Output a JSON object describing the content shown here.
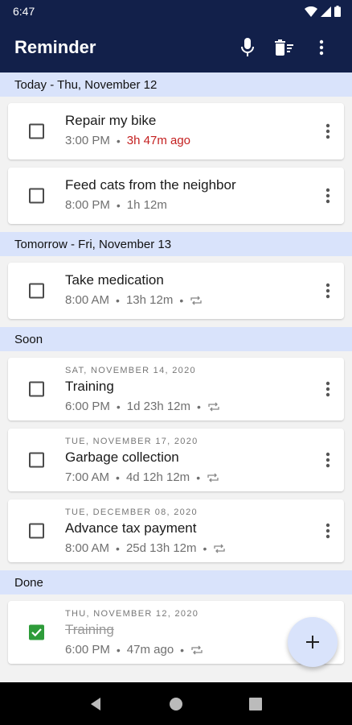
{
  "status_bar": {
    "time": "6:47"
  },
  "app_bar": {
    "title": "Reminder",
    "mic_icon": "mic-icon",
    "clear_icon": "delete-sweep-icon",
    "menu_icon": "more-vert-icon"
  },
  "sections": {
    "today": {
      "label": "Today - Thu, November 12"
    },
    "tomorrow": {
      "label": "Tomorrow - Fri, November 13"
    },
    "soon": {
      "label": "Soon"
    },
    "done": {
      "label": "Done"
    }
  },
  "reminders": {
    "r1": {
      "title": "Repair my bike",
      "time": "3:00 PM",
      "relative": "3h 47m ago",
      "overdue": true
    },
    "r2": {
      "title": "Feed cats from the neighbor",
      "time": "8:00 PM",
      "relative": "1h 12m"
    },
    "r3": {
      "title": "Take medication",
      "time": "8:00 AM",
      "relative": "13h 12m",
      "repeat": true
    },
    "r4": {
      "date": "SAT, NOVEMBER 14, 2020",
      "title": "Training",
      "time": "6:00 PM",
      "relative": "1d 23h 12m",
      "repeat": true
    },
    "r5": {
      "date": "TUE, NOVEMBER 17, 2020",
      "title": "Garbage collection",
      "time": "7:00 AM",
      "relative": "4d 12h 12m",
      "repeat": true
    },
    "r6": {
      "date": "TUE, DECEMBER 08, 2020",
      "title": "Advance tax payment",
      "time": "8:00 AM",
      "relative": "25d 13h 12m",
      "repeat": true
    },
    "r7": {
      "date": "THU, NOVEMBER 12, 2020",
      "title": "Training",
      "time": "6:00 PM",
      "relative": "47m ago",
      "repeat": true,
      "done": true
    }
  },
  "separator": "•",
  "fab": {
    "label": "+"
  },
  "colors": {
    "primary": "#12204a",
    "section_bg": "#d9e3fb",
    "overdue": "#c42020",
    "check_green": "#2e9c3a"
  }
}
